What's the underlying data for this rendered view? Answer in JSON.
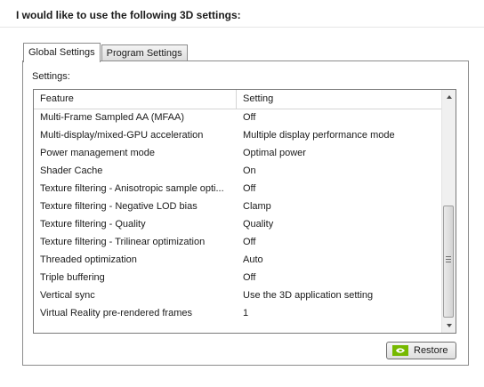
{
  "heading": "I would like to use the following 3D settings:",
  "tabs": [
    {
      "label": "Global Settings",
      "active": true
    },
    {
      "label": "Program Settings",
      "active": false
    }
  ],
  "settings_label": "Settings:",
  "table": {
    "columns": [
      "Feature",
      "Setting"
    ],
    "rows": [
      {
        "feature": "Multi-Frame Sampled AA (MFAA)",
        "setting": "Off"
      },
      {
        "feature": "Multi-display/mixed-GPU acceleration",
        "setting": "Multiple display performance mode"
      },
      {
        "feature": "Power management mode",
        "setting": "Optimal power"
      },
      {
        "feature": "Shader Cache",
        "setting": "On"
      },
      {
        "feature": "Texture filtering - Anisotropic sample opti...",
        "setting": "Off"
      },
      {
        "feature": "Texture filtering - Negative LOD bias",
        "setting": "Clamp"
      },
      {
        "feature": "Texture filtering - Quality",
        "setting": "Quality"
      },
      {
        "feature": "Texture filtering - Trilinear optimization",
        "setting": "Off"
      },
      {
        "feature": "Threaded optimization",
        "setting": "Auto"
      },
      {
        "feature": "Triple buffering",
        "setting": "Off"
      },
      {
        "feature": "Vertical sync",
        "setting": "Use the 3D application setting"
      },
      {
        "feature": "Virtual Reality pre-rendered frames",
        "setting": "1"
      }
    ]
  },
  "restore_button": {
    "label": "Restore",
    "icon": "nvidia-logo-icon"
  },
  "colors": {
    "nvidia_green": "#76b900"
  }
}
